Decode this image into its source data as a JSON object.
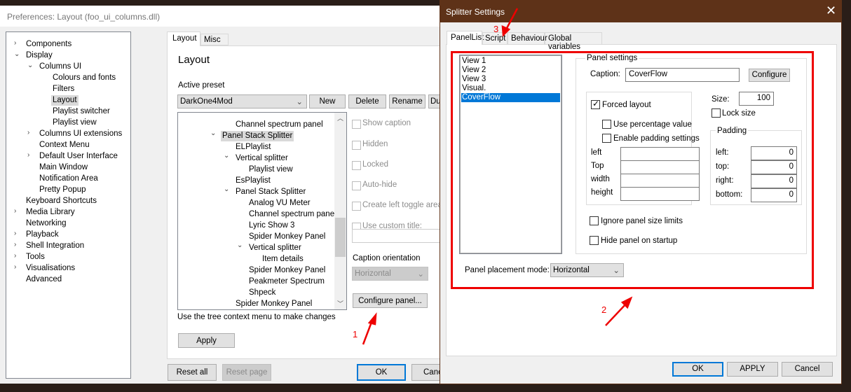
{
  "prefs": {
    "title": "Preferences: Layout (foo_ui_columns.dll)",
    "tree": [
      {
        "label": "Components",
        "level": 0,
        "arrow": "collapsed"
      },
      {
        "label": "Display",
        "level": 0,
        "arrow": "expanded"
      },
      {
        "label": "Columns UI",
        "level": 1,
        "arrow": "expanded"
      },
      {
        "label": "Colours and fonts",
        "level": 2
      },
      {
        "label": "Filters",
        "level": 2
      },
      {
        "label": "Layout",
        "level": 2,
        "selected": true
      },
      {
        "label": "Playlist switcher",
        "level": 2
      },
      {
        "label": "Playlist view",
        "level": 2
      },
      {
        "label": "Columns UI extensions",
        "level": 1,
        "arrow": "collapsed"
      },
      {
        "label": "Context Menu",
        "level": 1
      },
      {
        "label": "Default User Interface",
        "level": 1,
        "arrow": "collapsed"
      },
      {
        "label": "Main Window",
        "level": 1
      },
      {
        "label": "Notification Area",
        "level": 1
      },
      {
        "label": "Pretty Popup",
        "level": 1
      },
      {
        "label": "Keyboard Shortcuts",
        "level": 0
      },
      {
        "label": "Media Library",
        "level": 0,
        "arrow": "collapsed"
      },
      {
        "label": "Networking",
        "level": 0
      },
      {
        "label": "Playback",
        "level": 0,
        "arrow": "collapsed"
      },
      {
        "label": "Shell Integration",
        "level": 0,
        "arrow": "collapsed"
      },
      {
        "label": "Tools",
        "level": 0,
        "arrow": "collapsed"
      },
      {
        "label": "Visualisations",
        "level": 0,
        "arrow": "collapsed"
      },
      {
        "label": "Advanced",
        "level": 0
      }
    ],
    "tabs": [
      "Layout",
      "Misc"
    ],
    "heading": "Layout",
    "active_preset_label": "Active preset",
    "preset_value": "DarkOne4Mod",
    "preset_buttons": [
      "New",
      "Delete",
      "Rename",
      "Du"
    ],
    "panel_tree": [
      {
        "label": "Channel spectrum panel",
        "level": 1
      },
      {
        "label": "Panel Stack Splitter",
        "level": 0,
        "arrow": true,
        "selected": true
      },
      {
        "label": "ELPlaylist",
        "level": 1
      },
      {
        "label": "Vertical splitter",
        "level": 1,
        "arrow": true
      },
      {
        "label": "Playlist view",
        "level": 2
      },
      {
        "label": "EsPlaylist",
        "level": 1
      },
      {
        "label": "Panel Stack Splitter",
        "level": 1,
        "arrow": true
      },
      {
        "label": "Analog VU Meter",
        "level": 2
      },
      {
        "label": "Channel spectrum panel",
        "level": 2
      },
      {
        "label": "Lyric Show 3",
        "level": 2
      },
      {
        "label": "Spider Monkey Panel",
        "level": 2
      },
      {
        "label": "Vertical splitter",
        "level": 2,
        "arrow": true
      },
      {
        "label": "Item details",
        "level": 3
      },
      {
        "label": "Spider Monkey Panel",
        "level": 2
      },
      {
        "label": "Peakmeter Spectrum",
        "level": 2
      },
      {
        "label": "Shpeck",
        "level": 2
      },
      {
        "label": "Spider Monkey Panel",
        "level": 1
      },
      {
        "label": "Spider Monkey Panel",
        "level": 0
      }
    ],
    "options": [
      "Show caption",
      "Hidden",
      "Locked",
      "Auto-hide",
      "Create left toggle area",
      "Use custom title:"
    ],
    "caption_orientation_label": "Caption orientation",
    "caption_orientation_value": "Horizontal",
    "configure_panel": "Configure panel...",
    "hint": "Use the tree context menu to make changes",
    "apply": "Apply",
    "reset_all": "Reset all",
    "reset_page": "Reset page",
    "ok": "OK",
    "cancel": "Cancel"
  },
  "splitter": {
    "title": "Splitter Settings",
    "tabs": [
      "PanelList",
      "Script",
      "Behaviour",
      "Global variables"
    ],
    "panels": [
      "View 1",
      "View 2",
      "View 3",
      "Visual.",
      "CoverFlow"
    ],
    "selected_panel": "CoverFlow",
    "panel_settings_label": "Panel settings",
    "caption_label": "Caption:",
    "caption_value": "CoverFlow",
    "configure": "Configure",
    "forced_layout": "Forced layout",
    "use_percentage": "Use percentage value",
    "enable_padding": "Enable padding settings",
    "geom_labels": [
      "left",
      "Top",
      "width",
      "height"
    ],
    "size_label": "Size:",
    "size_value": "100",
    "lock_size": "Lock size",
    "padding_label": "Padding",
    "padding": [
      {
        "label": "left:",
        "value": "0"
      },
      {
        "label": "top:",
        "value": "0"
      },
      {
        "label": "right:",
        "value": "0"
      },
      {
        "label": "bottom:",
        "value": "0"
      }
    ],
    "ignore_limits": "Ignore panel size limits",
    "hide_startup": "Hide panel on startup",
    "placement_label": "Panel placement mode:",
    "placement_value": "Horizontal",
    "ok": "OK",
    "apply": "APPLY",
    "cancel": "Cancel"
  },
  "annotations": [
    "1",
    "2",
    "3"
  ],
  "colors": {
    "titlebar": "#5e3218",
    "selection": "#0078d7",
    "annotation": "#e00000"
  }
}
